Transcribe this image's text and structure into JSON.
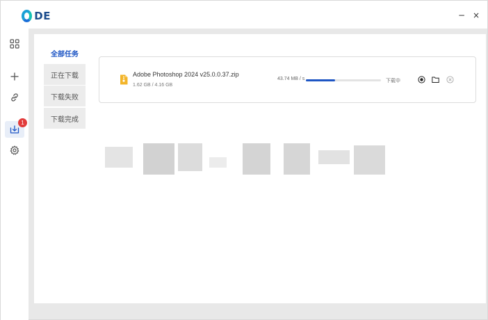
{
  "app": {
    "logo_text": "DE"
  },
  "window_controls": {
    "minimize": "−",
    "close": "×"
  },
  "nav": {
    "items": [
      {
        "name": "apps",
        "icon": "grid-icon"
      },
      {
        "name": "add",
        "icon": "plus-icon"
      },
      {
        "name": "link",
        "icon": "link-icon"
      },
      {
        "name": "downloads",
        "icon": "download-icon",
        "badge": "1",
        "active": true
      },
      {
        "name": "settings",
        "icon": "gear-icon"
      }
    ]
  },
  "tabs": {
    "all": "全部任务",
    "downloading": "正在下载",
    "failed": "下载失败",
    "done": "下载完成"
  },
  "task": {
    "file_name": "Adobe Photoshop 2024 v25.0.0.37.zip",
    "size": "1.62 GB / 4.16 GB",
    "speed": "43.74 MB / s",
    "progress": 0.39,
    "state": "下载中",
    "icon": "zip-file-icon"
  },
  "colors": {
    "accent": "#1d55c4",
    "badge": "#e23b3b",
    "file_icon": "#f3b52a"
  }
}
